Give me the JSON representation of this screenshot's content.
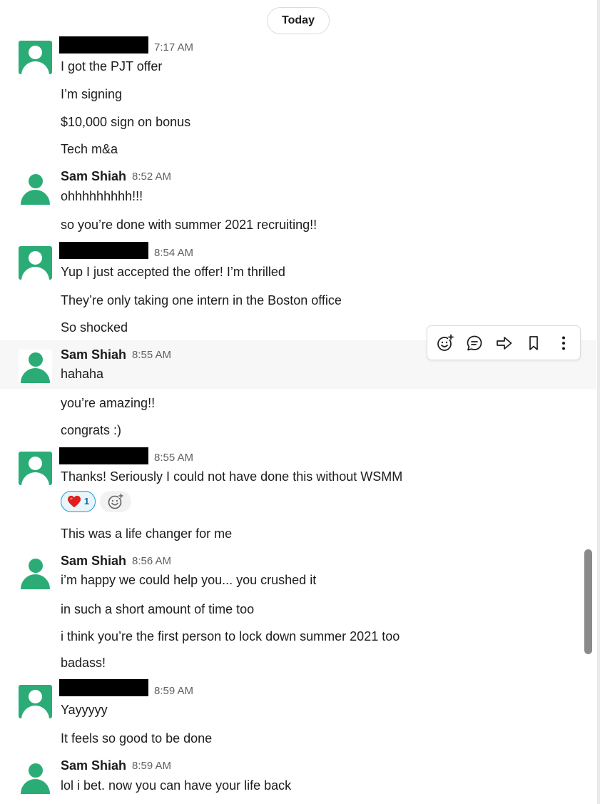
{
  "divider": {
    "label": "Today"
  },
  "users": {
    "sam": "Sam Shiah"
  },
  "messages": [
    {
      "sender": "redacted",
      "time": "7:17 AM",
      "lines": [
        "I got the PJT offer",
        "I’m signing",
        "$10,000 sign on bonus",
        "Tech m&a"
      ]
    },
    {
      "sender": "sam",
      "time": "8:52 AM",
      "lines": [
        "ohhhhhhhhh!!!",
        "so you’re done with summer 2021 recruiting!!"
      ]
    },
    {
      "sender": "redacted",
      "time": "8:54 AM",
      "lines": [
        "Yup I just accepted the offer! I’m thrilled",
        "They’re only taking one intern in the Boston office",
        "So shocked"
      ]
    },
    {
      "sender": "sam",
      "time": "8:55 AM",
      "lines": [
        "hahaha",
        "you’re amazing!!",
        "congrats :)"
      ]
    },
    {
      "sender": "redacted",
      "time": "8:55 AM",
      "lines": [
        "Thanks! Seriously I could not have done this without WSMM",
        "This was a life changer for me"
      ]
    },
    {
      "sender": "sam",
      "time": "8:56 AM",
      "lines": [
        "i’m happy we could help you... you crushed it",
        "in such a short amount of time too",
        "i think you’re the first person to lock down summer 2021 too",
        "badass!"
      ]
    },
    {
      "sender": "redacted",
      "time": "8:59 AM",
      "lines": [
        "Yayyyyy",
        "It feels so good to be done"
      ]
    },
    {
      "sender": "sam",
      "time": "8:59 AM",
      "lines": [
        "lol i bet. now you can have your life back"
      ]
    }
  ],
  "reaction": {
    "emoji": "red-heart-icon",
    "count": "1"
  },
  "hover_toolbar": [
    "add-reaction-icon",
    "reply-in-thread-icon",
    "share-message-icon",
    "save-bookmark-icon",
    "more-actions-icon"
  ],
  "colors": {
    "avatar_green": "#2bac76",
    "reaction_border": "#1d9bd1",
    "heart": "#e01e1e"
  }
}
